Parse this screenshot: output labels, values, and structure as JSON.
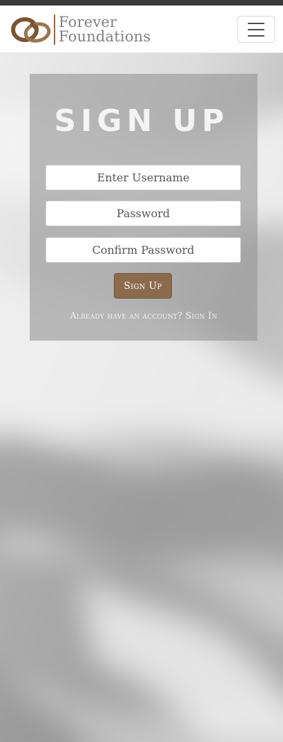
{
  "brand": {
    "line1": "Forever",
    "line2": "Foundations",
    "logo_icon": "interlocked-rings-icon",
    "accent_color": "#8a6a48"
  },
  "nav": {
    "menu_icon": "hamburger-menu-icon"
  },
  "form": {
    "title": "SIGN UP",
    "username_placeholder": "Enter Username",
    "password_placeholder": "Password",
    "confirm_placeholder": "Confirm Password",
    "submit_label": "Sign Up",
    "signin_prompt": "Already have an account? Sign In",
    "button_color": "#8c6a4c"
  }
}
